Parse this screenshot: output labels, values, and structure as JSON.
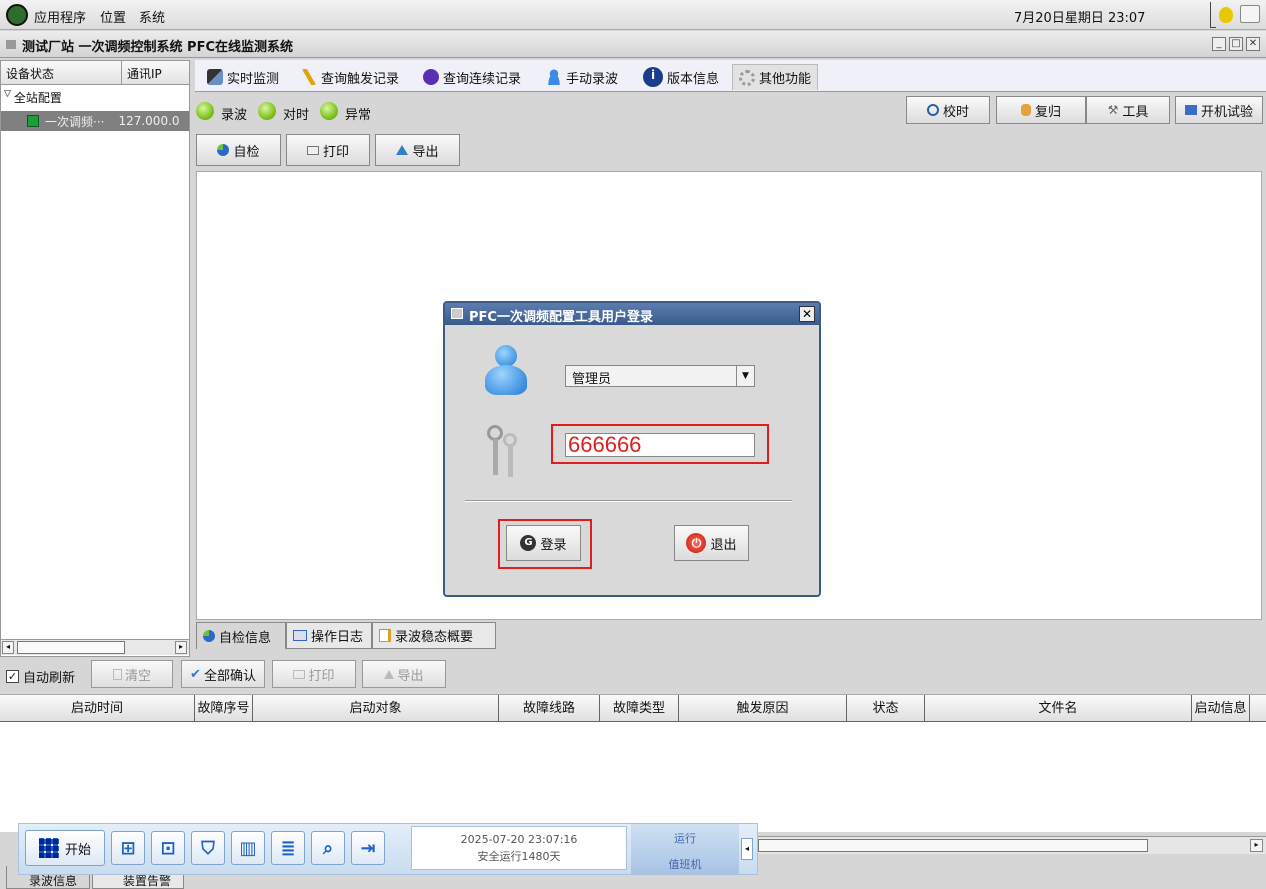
{
  "topbar": {
    "menus": [
      "应用程序",
      "位置",
      "系统"
    ],
    "datetime": "7月20日星期日 23:07"
  },
  "window": {
    "title": "测试厂站 一次调频控制系统 PFC在线监测系统"
  },
  "leftpane": {
    "col_status": "设备状态",
    "col_ip": "通讯IP",
    "tree_root": "全站配置",
    "tree_child_name": "一次调频···",
    "tree_child_ip": "127.000.0"
  },
  "tabs": [
    {
      "label": "实时监测",
      "icon": "monitor-icon"
    },
    {
      "label": "查询触发记录",
      "icon": "pen-icon"
    },
    {
      "label": "查询连续记录",
      "icon": "record-icon"
    },
    {
      "label": "手动录波",
      "icon": "person-icon"
    },
    {
      "label": "版本信息",
      "icon": "info-icon"
    },
    {
      "label": "其他功能",
      "icon": "gear-icon"
    }
  ],
  "status_leds": [
    "录波",
    "对时",
    "异常"
  ],
  "right_buttons": [
    "校时",
    "复归",
    "工具",
    "开机试验"
  ],
  "sub_buttons": [
    "自检",
    "打印",
    "导出"
  ],
  "dialog": {
    "title": "PFC一次调频配置工具用户登录",
    "user_selected": "管理员",
    "password_value": "666666",
    "login_label": "登录",
    "exit_label": "退出"
  },
  "bottom_tabs": [
    "自检信息",
    "操作日志",
    "录波稳态概要"
  ],
  "bottom_toolbar": {
    "auto_refresh": "自动刷新",
    "clear": "清空",
    "confirm_all": "全部确认",
    "print": "打印",
    "export": "导出"
  },
  "table_columns": [
    "启动时间",
    "故障序号",
    "启动对象",
    "故障线路",
    "故障类型",
    "触发原因",
    "状态",
    "文件名",
    "启动信息"
  ],
  "taskbar": {
    "start": "开始",
    "datetime": "2025-07-20 23:07:16",
    "uptime": "安全运行1480天",
    "state": "运行",
    "role": "值班机"
  },
  "partial_tabs": [
    "录波信息",
    "装置告警"
  ],
  "colors": {
    "accent": "#3a5a8a",
    "highlight": "#e01e1e",
    "led": "#7fc21e"
  }
}
